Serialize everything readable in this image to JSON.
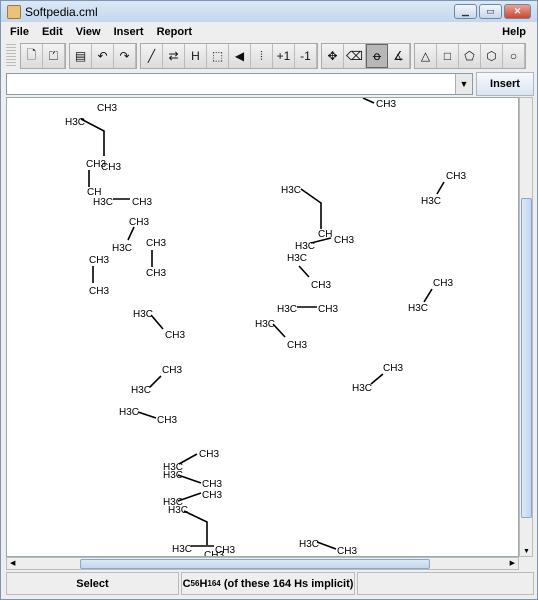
{
  "window": {
    "title": "Softpedia.cml"
  },
  "menu": {
    "file": "File",
    "edit": "Edit",
    "view": "View",
    "insert": "Insert",
    "report": "Report",
    "help": "Help"
  },
  "toolbar": {
    "groups": [
      [
        "new-file",
        "open-file"
      ],
      [
        "save",
        "undo",
        "redo"
      ],
      [
        "single-bond",
        "reaction-arrows",
        "hydrogen-labels",
        "select-region",
        "wedge-bond",
        "hash-bond",
        "charge-plus",
        "charge-minus"
      ],
      [
        "move",
        "eraser",
        "lasso",
        "angle"
      ],
      [
        "triangle",
        "square",
        "pentagon",
        "hexagon",
        "heptagon"
      ]
    ],
    "selected": "lasso",
    "text": {
      "charge-plus": "+1",
      "charge-minus": "-1"
    }
  },
  "smiles_input": {
    "value": "",
    "insert_label": "Insert"
  },
  "canvas": {
    "methyl_left": "H3C",
    "methyl_right": "CH3",
    "methine": "CH"
  },
  "status": {
    "mode": "Select",
    "c": "C",
    "c_count": "56",
    "h": "H",
    "h_count": "164",
    "note": "(of these 164 Hs implicit)",
    "extra": ""
  }
}
